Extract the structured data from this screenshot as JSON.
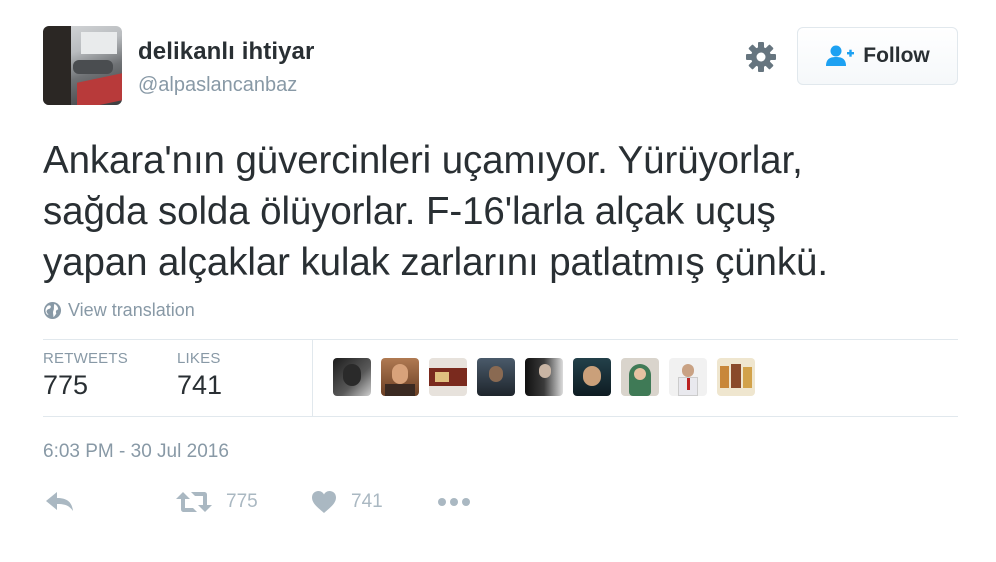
{
  "user": {
    "name": "delikanlı ihtiyar",
    "handle": "@alpaslancanbaz"
  },
  "follow_label": "Follow",
  "tweet": {
    "lines": [
      "Ankara'nın güvercinleri uçamıyor. Yürüyorlar,",
      "sağda solda ölüyorlar. F-16'larla alçak uçuş",
      "yapan alçaklar kulak zarlarını patlatmış çünkü."
    ],
    "translate_label": "View translation"
  },
  "stats": {
    "retweets_label": "RETWEETS",
    "retweets": "775",
    "likes_label": "LIKES",
    "likes": "741"
  },
  "timestamp": "6:03 PM - 30 Jul 2016",
  "actions": {
    "retweet_count": "775",
    "like_count": "741"
  },
  "icons": [
    "gear-icon",
    "follow-person-icon",
    "globe-icon",
    "reply-icon",
    "retweet-icon",
    "heart-icon",
    "more-icon"
  ],
  "colors": {
    "text": "#292f33",
    "muted": "#8899a6",
    "action_icon": "#aab8c2",
    "follow_icon": "#1da1f2",
    "border": "#e1e8ed"
  }
}
